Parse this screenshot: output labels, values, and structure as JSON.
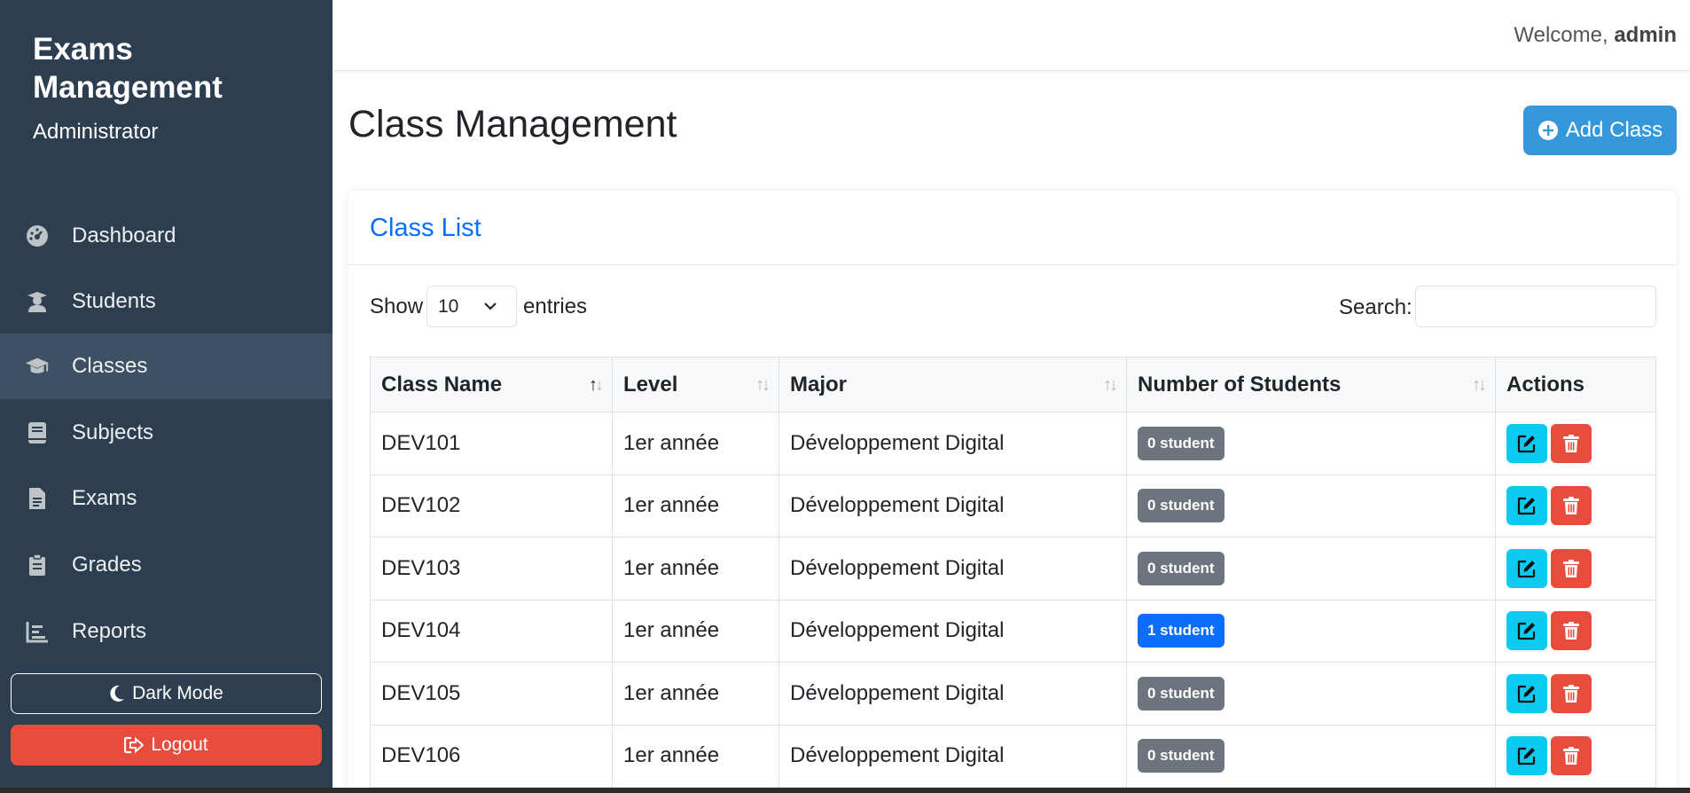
{
  "sidebar": {
    "brand_title": "Exams Management",
    "brand_role": "Administrator",
    "items": [
      {
        "label": "Dashboard",
        "icon": "gauge-icon"
      },
      {
        "label": "Students",
        "icon": "user-graduate-icon"
      },
      {
        "label": "Classes",
        "icon": "graduation-cap-icon",
        "active": true
      },
      {
        "label": "Subjects",
        "icon": "book-icon"
      },
      {
        "label": "Exams",
        "icon": "file-icon"
      },
      {
        "label": "Grades",
        "icon": "clipboard-icon"
      },
      {
        "label": "Reports",
        "icon": "bar-chart-icon"
      }
    ],
    "dark_mode_label": "Dark Mode",
    "logout_label": "Logout"
  },
  "topbar": {
    "welcome_prefix": "Welcome,",
    "username": "admin"
  },
  "page": {
    "title": "Class Management",
    "add_button_label": "Add Class"
  },
  "card": {
    "title": "Class List",
    "show_label": "Show",
    "page_size": "10",
    "entries_label": "entries",
    "search_label": "Search:",
    "search_value": ""
  },
  "table": {
    "columns": [
      "Class Name",
      "Level",
      "Major",
      "Number of Students",
      "Actions"
    ],
    "rows": [
      {
        "name": "DEV101",
        "level": "1er année",
        "major": "Développement Digital",
        "students": "0 student",
        "badge": "secondary"
      },
      {
        "name": "DEV102",
        "level": "1er année",
        "major": "Développement Digital",
        "students": "0 student",
        "badge": "secondary"
      },
      {
        "name": "DEV103",
        "level": "1er année",
        "major": "Développement Digital",
        "students": "0 student",
        "badge": "secondary"
      },
      {
        "name": "DEV104",
        "level": "1er année",
        "major": "Développement Digital",
        "students": "1 student",
        "badge": "primary"
      },
      {
        "name": "DEV105",
        "level": "1er année",
        "major": "Développement Digital",
        "students": "0 student",
        "badge": "secondary"
      },
      {
        "name": "DEV106",
        "level": "1er année",
        "major": "Développement Digital",
        "students": "0 student",
        "badge": "secondary"
      }
    ]
  },
  "colors": {
    "sidebar_bg": "#2c3e50",
    "sidebar_active": "#3e5063",
    "accent_blue": "#3498db",
    "link_blue": "#0d6efd",
    "danger": "#e74c3c",
    "info": "#0dcaf0",
    "badge_secondary": "#6c757d"
  }
}
